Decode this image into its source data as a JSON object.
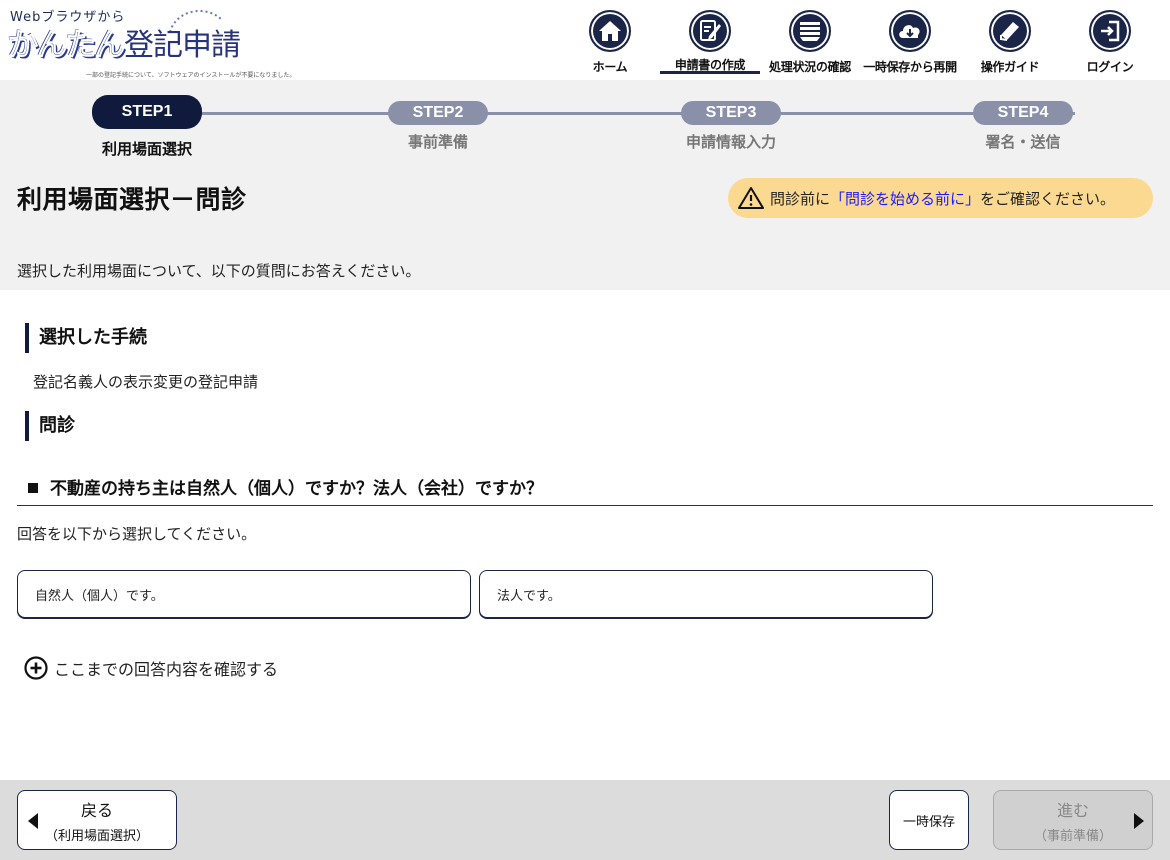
{
  "header": {
    "logo_top": "Webブラウザから",
    "logo_kantan": "かんたん",
    "logo_touki": "登記申請",
    "logo_sub": "一部の登記手続について、ソフトウェアのインストールが不要になりました。",
    "nav": [
      {
        "label": "ホーム",
        "icon": "home-icon"
      },
      {
        "label": "申請書の作成",
        "icon": "edit-document-icon",
        "active": true
      },
      {
        "label": "処理状況の確認",
        "icon": "status-list-icon"
      },
      {
        "label": "一時保存から再開",
        "icon": "cloud-download-icon"
      },
      {
        "label": "操作ガイド",
        "icon": "book-icon"
      },
      {
        "label": "ログイン",
        "icon": "login-icon"
      }
    ]
  },
  "steps": [
    {
      "pill": "STEP1",
      "label": "利用場面選択",
      "active": true
    },
    {
      "pill": "STEP2",
      "label": "事前準備",
      "active": false
    },
    {
      "pill": "STEP3",
      "label": "申請情報入力",
      "active": false
    },
    {
      "pill": "STEP4",
      "label": "署名・送信",
      "active": false
    }
  ],
  "page": {
    "title": "利用場面選択－問診",
    "notice_before": "問診前に",
    "notice_link": "「問診を始める前に」",
    "notice_after": "をご確認ください。",
    "lead": "選択した利用場面について、以下の質問にお答えください。"
  },
  "procedure": {
    "heading": "選択した手続",
    "value": "登記名義人の表示変更の登記申請"
  },
  "interview": {
    "heading": "問診",
    "question": "不動産の持ち主は自然人（個人）ですか？法人（会社）ですか？",
    "instruction": "回答を以下から選択してください。",
    "choices": [
      "自然人（個人）です。",
      "法人です。"
    ],
    "confirm_link": "ここまでの回答内容を確認する"
  },
  "footer": {
    "back_label": "戻る",
    "back_sub": "（利用場面選択）",
    "save_label": "一時保存",
    "next_label": "進む",
    "next_sub": "（事前準備）"
  },
  "colors": {
    "navy": "#1b2547",
    "step_active": "#101a3d",
    "step_inactive": "#8a90a8",
    "notice_bg": "#fbd990",
    "link": "#1a1aff",
    "band_bg": "#f1f1f1",
    "footer_bg": "#dcdcdc"
  }
}
